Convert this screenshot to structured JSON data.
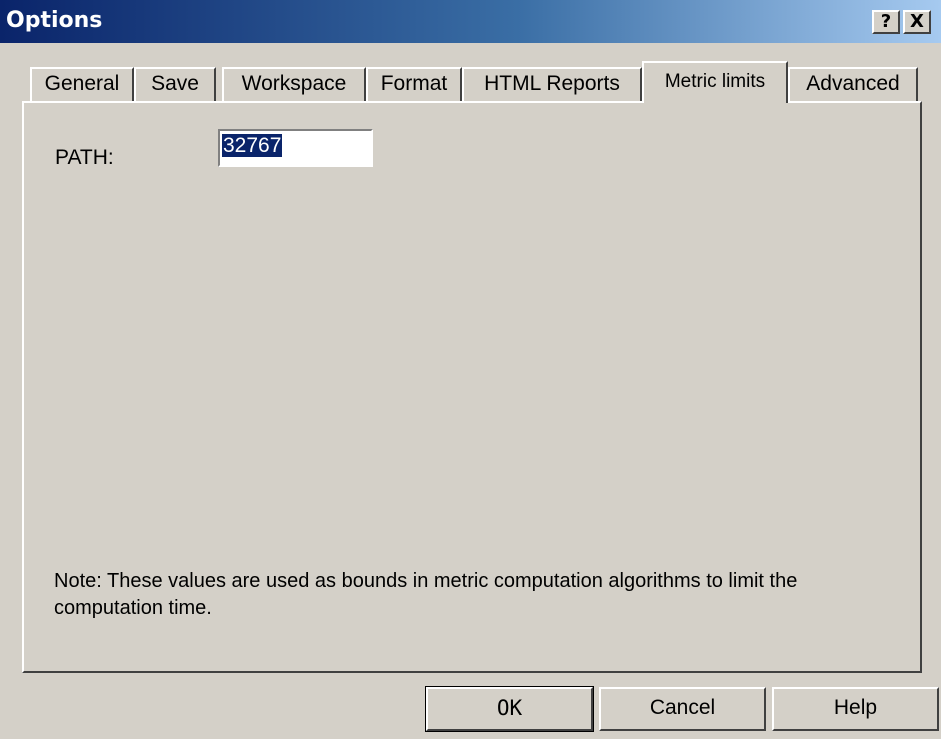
{
  "window": {
    "title": "Options"
  },
  "titlebar_buttons": {
    "help": "?",
    "close": "X"
  },
  "tabs": [
    {
      "label": "General",
      "active": false
    },
    {
      "label": "Save",
      "active": false
    },
    {
      "label": "Workspace",
      "active": false
    },
    {
      "label": "Format",
      "active": false
    },
    {
      "label": "HTML Reports",
      "active": false
    },
    {
      "label": "Metric limits",
      "active": true
    },
    {
      "label": "Advanced",
      "active": false
    }
  ],
  "metric_limits": {
    "path_label": "PATH:",
    "path_value": "32767",
    "note": "Note: These values are used as bounds in metric computation algorithms to limit the computation time."
  },
  "buttons": {
    "ok": "OK",
    "cancel": "Cancel",
    "help": "Help"
  },
  "colors": {
    "titlebar_start": "#0a246a",
    "titlebar_end": "#a6caf0",
    "face": "#d4d0c8",
    "selection": "#0a246a"
  }
}
